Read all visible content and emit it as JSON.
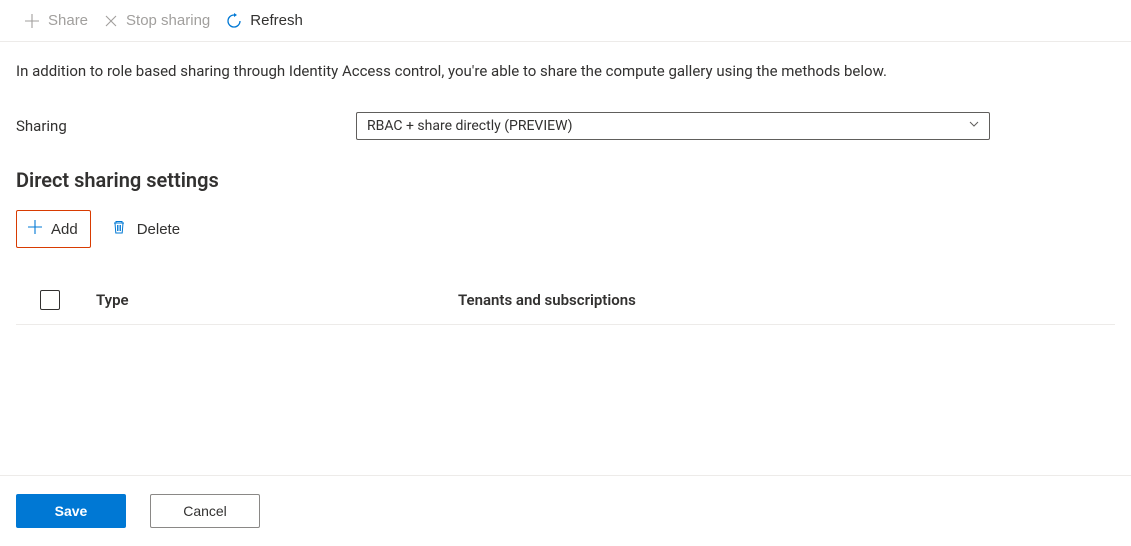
{
  "toolbar": {
    "share_label": "Share",
    "stop_sharing_label": "Stop sharing",
    "refresh_label": "Refresh"
  },
  "description": "In addition to role based sharing through Identity Access control, you're able to share the compute gallery using the methods below.",
  "sharing": {
    "label": "Sharing",
    "selected": "RBAC + share directly (PREVIEW)"
  },
  "section_heading": "Direct sharing settings",
  "actions": {
    "add_label": "Add",
    "delete_label": "Delete"
  },
  "table": {
    "columns": {
      "type": "Type",
      "tenants": "Tenants and subscriptions"
    },
    "rows": []
  },
  "footer": {
    "save_label": "Save",
    "cancel_label": "Cancel"
  },
  "colors": {
    "accent": "#0078d4",
    "highlight_border": "#d83b01"
  }
}
